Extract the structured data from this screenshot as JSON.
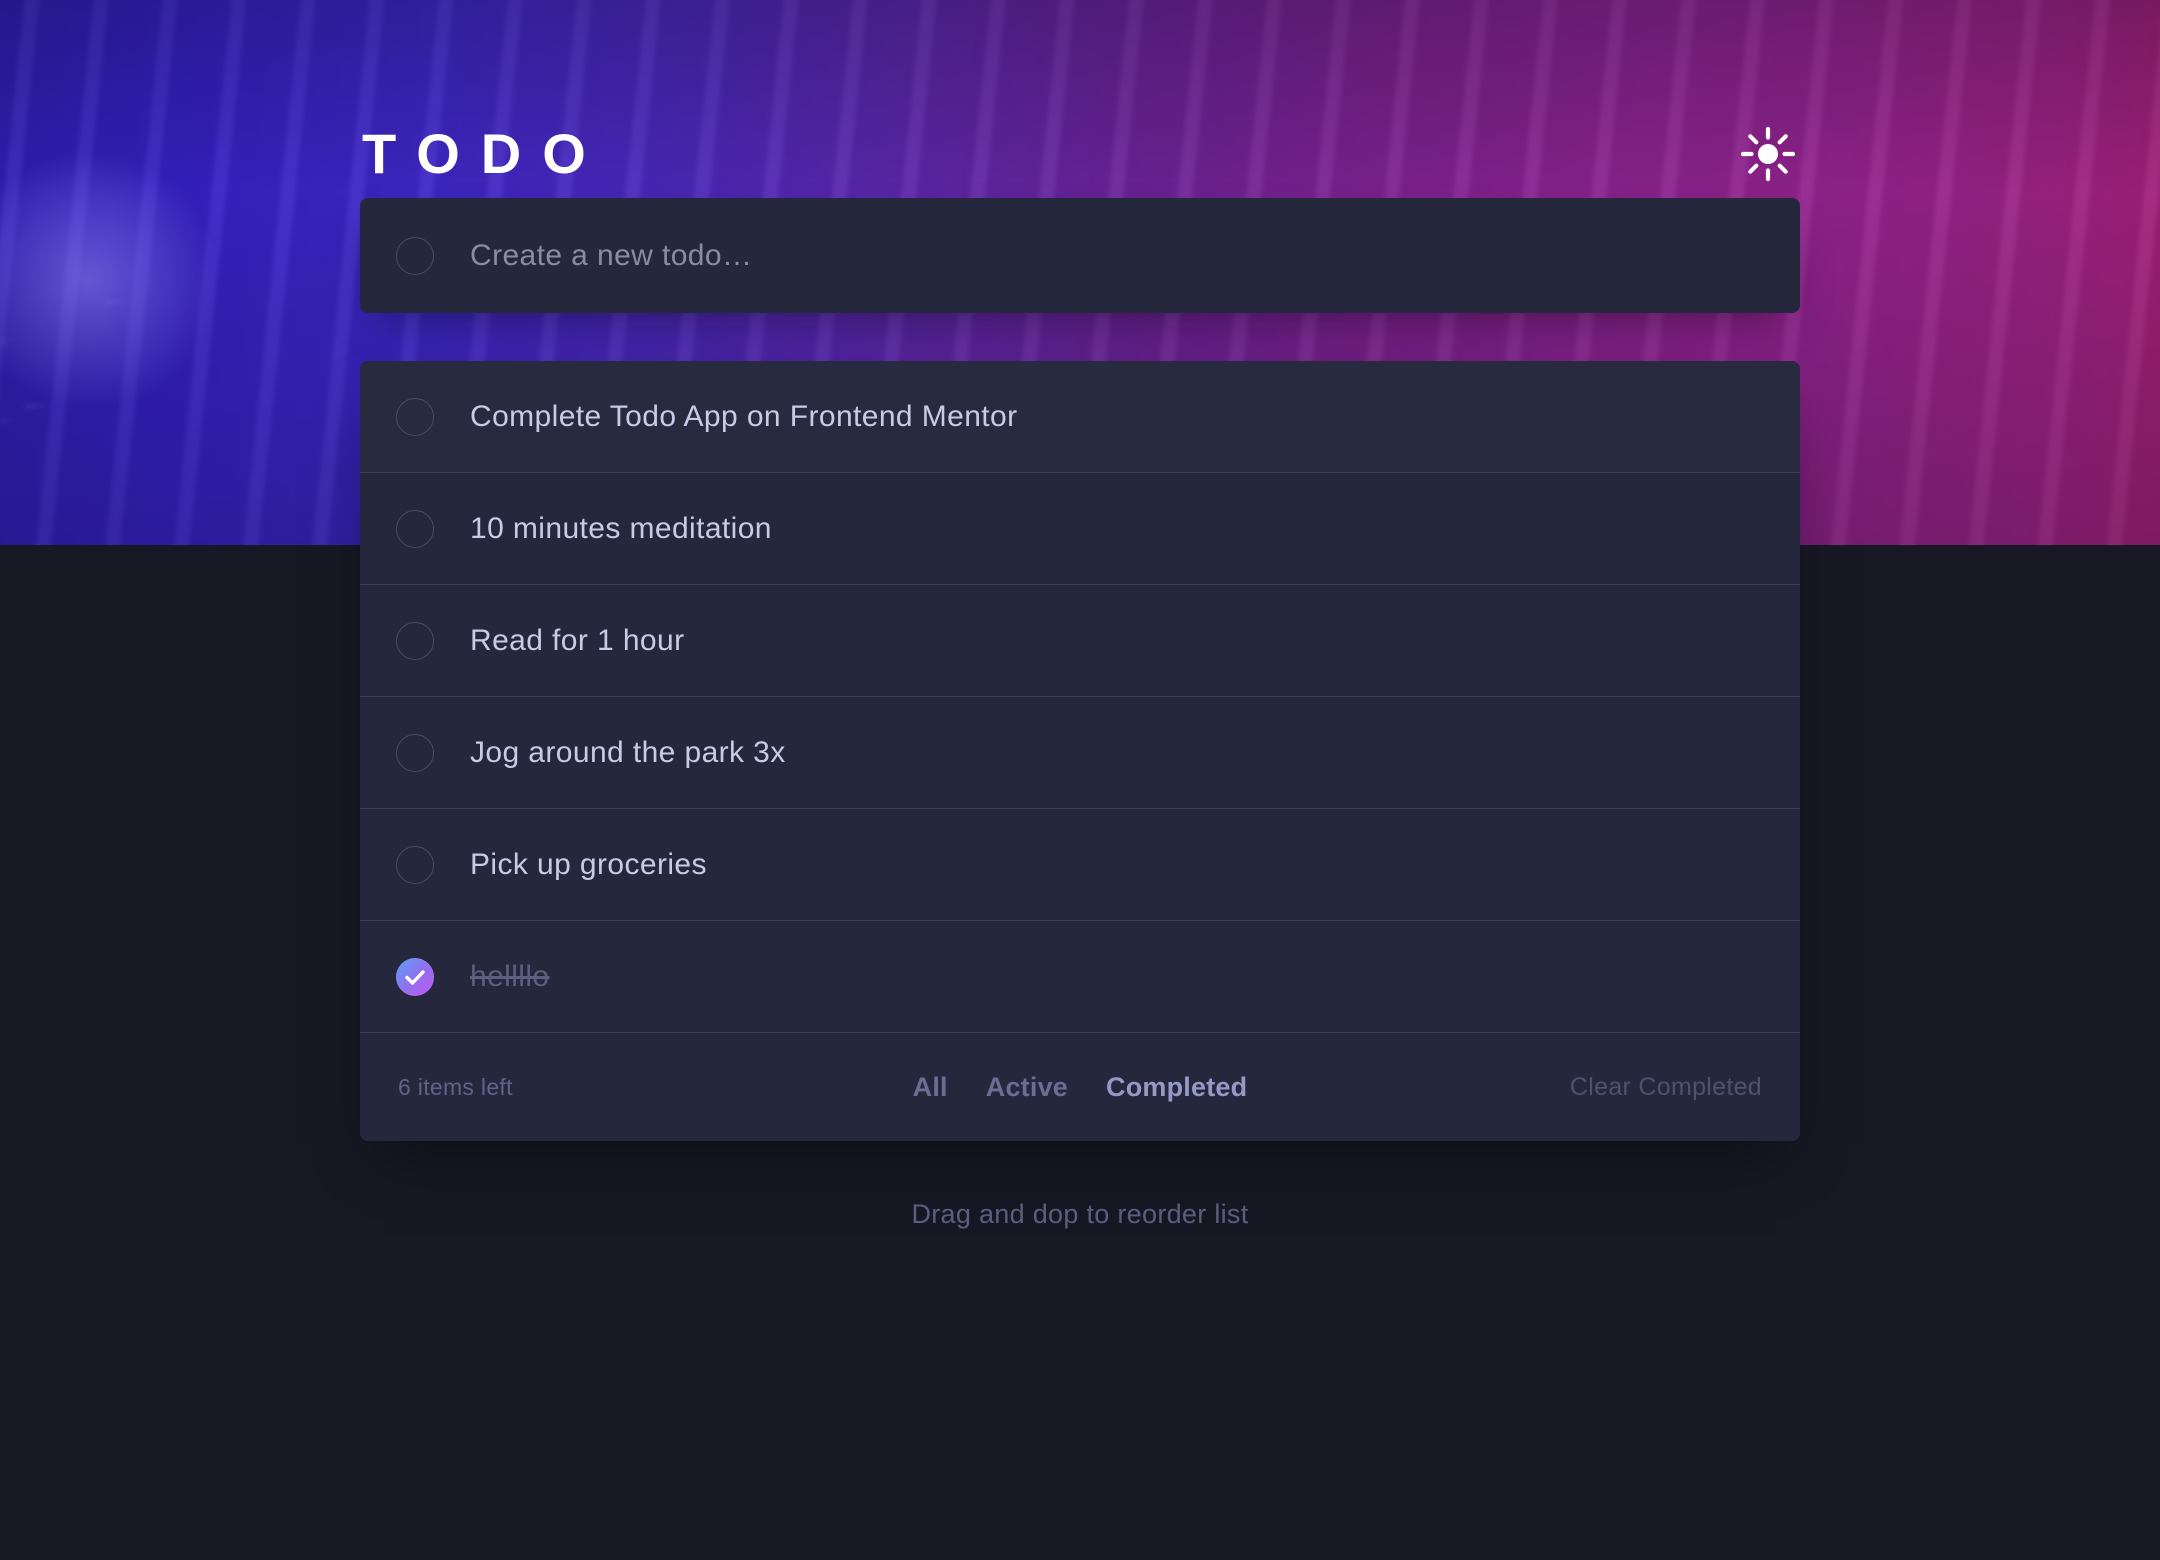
{
  "app": {
    "title": "TODO",
    "theme_toggle_icon": "sun-icon",
    "background_accent_left": "#3621c4",
    "background_accent_right": "#a41f72",
    "page_background": "#171823",
    "card_background": "#25273D",
    "text_color": "#C8CBE7",
    "muted_text_color": "#5B5E7E",
    "check_gradient_start": "#579EF5",
    "check_gradient_end": "#C058F3"
  },
  "new_todo": {
    "placeholder": "Create a new todo…",
    "value": "",
    "checkbox_icon": "empty-circle-icon"
  },
  "todos": [
    {
      "label": "Complete Todo App on Frontend Mentor",
      "completed": false
    },
    {
      "label": "10 minutes meditation",
      "completed": false
    },
    {
      "label": "Read for 1 hour",
      "completed": false
    },
    {
      "label": "Jog around the park 3x",
      "completed": false
    },
    {
      "label": "Pick up groceries",
      "completed": false
    },
    {
      "label": "hellllo",
      "completed": true
    }
  ],
  "footer": {
    "items_left": "6 items left",
    "filters": [
      {
        "label": "All",
        "active": false
      },
      {
        "label": "Active",
        "active": false
      },
      {
        "label": "Completed",
        "active": true
      }
    ],
    "clear_completed": "Clear Completed"
  },
  "hint": "Drag and dop to reorder list"
}
